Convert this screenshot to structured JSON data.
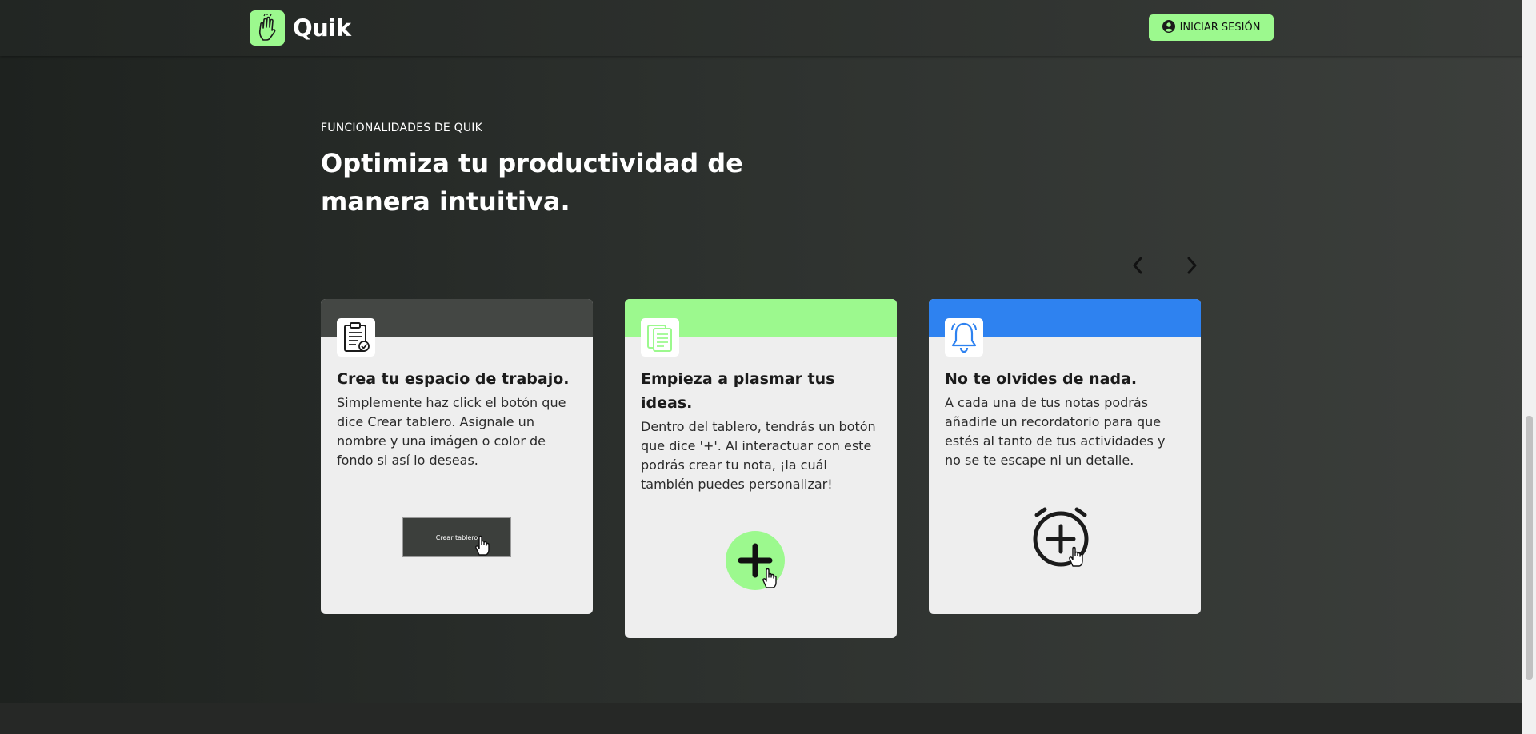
{
  "navbar": {
    "brand": "Quik",
    "login_label": "INICIAR SESIÓN"
  },
  "features": {
    "eyebrow": "FUNCIONALIDADES DE QUIK",
    "headline": "Optimiza tu productividad de manera intuitiva."
  },
  "cards": [
    {
      "title": "Crea tu espacio de trabajo.",
      "text": "Simplemente haz click el botón que dice Crear tablero. Asignale un nombre y una imágen o color de fondo si así lo deseas.",
      "band_color": "#444744",
      "button_label": "Crear tablero",
      "icon": "clipboard-icon"
    },
    {
      "title": "Empieza a plasmar tus ideas.",
      "text": "Dentro del tablero, tendrás un botón que dice '+'. Al interactuar con este podrás crear tu nota, ¡la cuál también puedes personalizar!",
      "band_color": "#9cf98e",
      "icon": "notes-icon"
    },
    {
      "title": "No te olvides de nada.",
      "text": "A cada una de tus notas podrás añadirle un recordatorio para que estés al tanto de tus actividades y no se te escape ni un detalle.",
      "band_color": "#2e82f0",
      "icon": "bell-icon"
    }
  ],
  "colors": {
    "accent_green": "#9cf98e",
    "accent_blue": "#2e82f0",
    "card_bg": "#eeeeee"
  }
}
